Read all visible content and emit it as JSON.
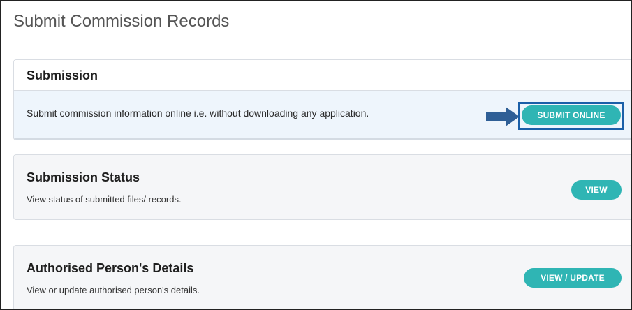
{
  "page": {
    "title": "Submit Commission Records"
  },
  "submission": {
    "heading": "Submission",
    "description": "Submit commission information online i.e. without downloading any application.",
    "button_label": "SUBMIT ONLINE"
  },
  "status": {
    "title": "Submission Status",
    "description": "View status of submitted files/ records.",
    "button_label": "VIEW"
  },
  "authorised": {
    "title": "Authorised Person's Details",
    "description": "View or update authorised person's details.",
    "button_label": "VIEW / UPDATE"
  },
  "colors": {
    "button_teal": "#2fb5b4",
    "highlight_blue": "#1b5fa8",
    "arrow_blue": "#2f5f96",
    "panel_light_blue": "#eef5fc"
  },
  "icons": {
    "callout": "arrow-right-icon"
  }
}
